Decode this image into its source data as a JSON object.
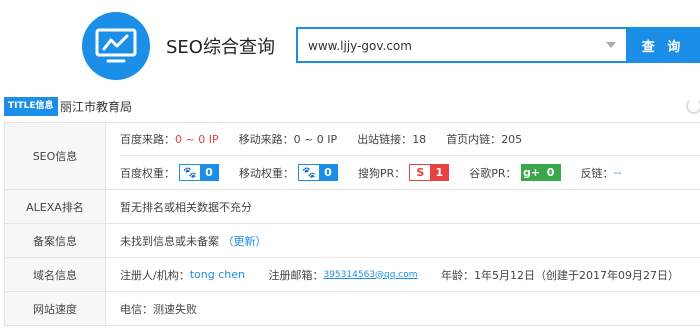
{
  "header": {
    "app_title": "SEO综合查询",
    "search_value": "www.ljjy-gov.com",
    "search_button": "查 询"
  },
  "title_row": {
    "tag": "TITLE信息",
    "text": "丽江市教育局"
  },
  "rows": {
    "seo": {
      "label": "SEO信息",
      "baidu_source_label": "百度来路：",
      "baidu_source_value": "0 ~ 0 IP",
      "mobile_source_label": "移动来路：",
      "mobile_source_value": "0 ~ 0 IP",
      "outbound_label": "出站链接：",
      "outbound_value": "18",
      "inbound_label": "首页内链：",
      "inbound_value": "205",
      "baidu_weight_label": "百度权重：",
      "baidu_weight_value": "0",
      "mobile_weight_label": "移动权重：",
      "mobile_weight_value": "0",
      "sogou_label": "搜狗PR：",
      "sogou_icon": "S",
      "sogou_value": "1",
      "google_label": "谷歌PR：",
      "google_icon": "g+",
      "google_value": "0",
      "backlink_label": "反链：",
      "backlink_value": "--"
    },
    "alexa": {
      "label": "ALEXA排名",
      "value": "暂无排名或相关数据不充分"
    },
    "icp": {
      "label": "备案信息",
      "value": "未找到信息或未备案",
      "update_link": "（更新）"
    },
    "whois": {
      "label": "域名信息",
      "registrant_label": "注册人/机构：",
      "registrant_value": "tong chen",
      "email_label": "注册邮箱：",
      "email_value": "395314563@qq.com",
      "age_label": "年龄：",
      "age_value": "1年5月12日（创建于2017年09月27日）"
    },
    "speed": {
      "label": "网站速度",
      "value": "电信：测速失败"
    }
  },
  "colors": {
    "accent": "#1b8fe8",
    "red": "#e64340",
    "green": "#3aa84a"
  }
}
